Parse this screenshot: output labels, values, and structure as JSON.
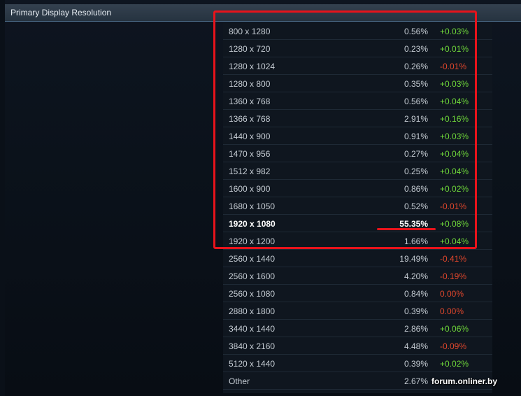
{
  "header": {
    "title": "Primary Display Resolution"
  },
  "rows": [
    {
      "resolution": "800 x 1280",
      "percent": "0.56%",
      "change": "+0.03%",
      "trend": "up"
    },
    {
      "resolution": "1280 x 720",
      "percent": "0.23%",
      "change": "+0.01%",
      "trend": "up"
    },
    {
      "resolution": "1280 x 1024",
      "percent": "0.26%",
      "change": "-0.01%",
      "trend": "down"
    },
    {
      "resolution": "1280 x 800",
      "percent": "0.35%",
      "change": "+0.03%",
      "trend": "up"
    },
    {
      "resolution": "1360 x 768",
      "percent": "0.56%",
      "change": "+0.04%",
      "trend": "up"
    },
    {
      "resolution": "1366 x 768",
      "percent": "2.91%",
      "change": "+0.16%",
      "trend": "up"
    },
    {
      "resolution": "1440 x 900",
      "percent": "0.91%",
      "change": "+0.03%",
      "trend": "up"
    },
    {
      "resolution": "1470 x 956",
      "percent": "0.27%",
      "change": "+0.04%",
      "trend": "up"
    },
    {
      "resolution": "1512 x 982",
      "percent": "0.25%",
      "change": "+0.04%",
      "trend": "up"
    },
    {
      "resolution": "1600 x 900",
      "percent": "0.86%",
      "change": "+0.02%",
      "trend": "up"
    },
    {
      "resolution": "1680 x 1050",
      "percent": "0.52%",
      "change": "-0.01%",
      "trend": "down"
    },
    {
      "resolution": "1920 x 1080",
      "percent": "55.35%",
      "change": "+0.08%",
      "trend": "up",
      "bold": true
    },
    {
      "resolution": "1920 x 1200",
      "percent": "1.66%",
      "change": "+0.04%",
      "trend": "up"
    },
    {
      "resolution": "2560 x 1440",
      "percent": "19.49%",
      "change": "-0.41%",
      "trend": "down"
    },
    {
      "resolution": "2560 x 1600",
      "percent": "4.20%",
      "change": "-0.19%",
      "trend": "down"
    },
    {
      "resolution": "2560 x 1080",
      "percent": "0.84%",
      "change": "0.00%",
      "trend": "zero"
    },
    {
      "resolution": "2880 x 1800",
      "percent": "0.39%",
      "change": "0.00%",
      "trend": "zero"
    },
    {
      "resolution": "3440 x 1440",
      "percent": "2.86%",
      "change": "+0.06%",
      "trend": "up"
    },
    {
      "resolution": "3840 x 2160",
      "percent": "4.48%",
      "change": "-0.09%",
      "trend": "down"
    },
    {
      "resolution": "5120 x 1440",
      "percent": "0.39%",
      "change": "+0.02%",
      "trend": "up"
    },
    {
      "resolution": "Other",
      "percent": "2.67%",
      "change": "",
      "trend": "up"
    }
  ],
  "watermark": "forum.onliner.by",
  "colors": {
    "positive": "#6fd83a",
    "negative": "#e2472c",
    "annotation_red": "#e8131b",
    "header_bg": "#2e3b48"
  }
}
